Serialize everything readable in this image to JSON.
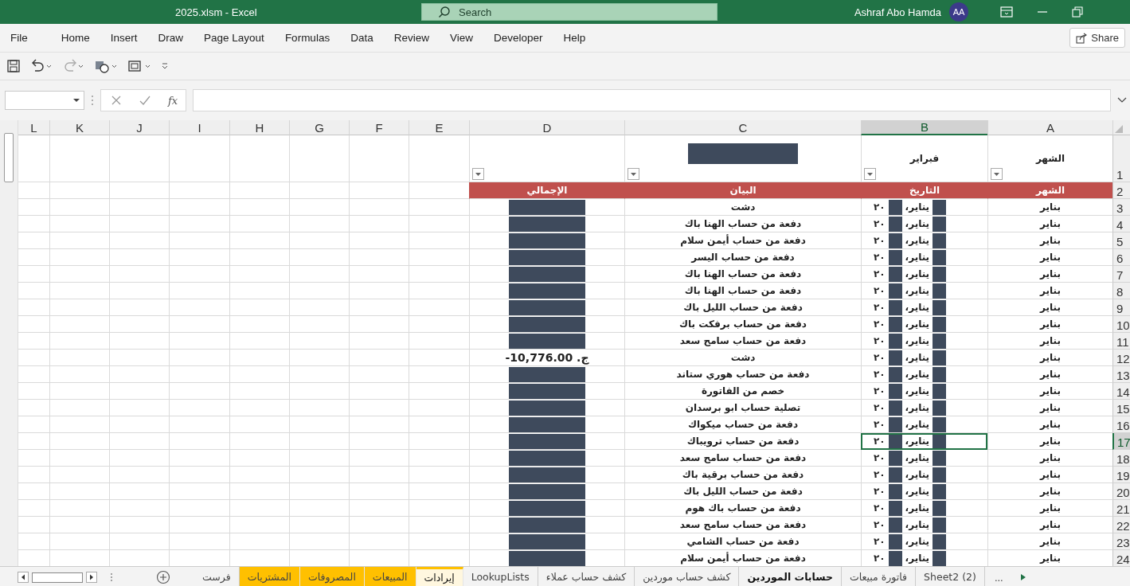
{
  "window": {
    "title": "2025.xlsm  -  Excel",
    "search_placeholder": "Search",
    "user": "Ashraf Abo Hamda",
    "avatar": "AA"
  },
  "file_menu": "File",
  "menu": [
    {
      "label": "Help",
      "selected": false
    },
    {
      "label": "Developer",
      "selected": false
    },
    {
      "label": "View",
      "selected": false
    },
    {
      "label": "Review",
      "selected": false
    },
    {
      "label": "Data",
      "selected": false
    },
    {
      "label": "Formulas",
      "selected": false
    },
    {
      "label": "Page Layout",
      "selected": false
    },
    {
      "label": "Draw",
      "selected": false
    },
    {
      "label": "Insert",
      "selected": false
    },
    {
      "label": "Home",
      "selected": false
    }
  ],
  "share_label": "Share",
  "formula_bar": {
    "fx": "fx"
  },
  "columns": [
    {
      "label": "A",
      "selected": false
    },
    {
      "label": "B",
      "selected": true
    },
    {
      "label": "C",
      "selected": false
    },
    {
      "label": "D",
      "selected": false
    },
    {
      "label": "E",
      "selected": false
    },
    {
      "label": "F",
      "selected": false
    },
    {
      "label": "G",
      "selected": false
    },
    {
      "label": "H",
      "selected": false
    },
    {
      "label": "I",
      "selected": false
    },
    {
      "label": "J",
      "selected": false
    },
    {
      "label": "K",
      "selected": false
    },
    {
      "label": "L",
      "selected": false
    }
  ],
  "title_row": {
    "number": "1",
    "cells": [
      {
        "kind": "text",
        "text": "الشهر",
        "filter": true
      },
      {
        "kind": "text",
        "text": "فبراير",
        "filter": true
      },
      {
        "kind": "redacted",
        "filter": true
      },
      {
        "kind": "empty",
        "filter": true
      }
    ]
  },
  "header_row": {
    "number": "2",
    "cells": [
      "الشهر",
      "التاريخ",
      "البيان",
      "الإجمالي"
    ]
  },
  "rows": [
    {
      "number": "3",
      "month": "بناير",
      "date_month": "يناير،",
      "date_year": "٢٠",
      "description": "دشت",
      "total": {
        "kind": "redacted"
      },
      "selected": false
    },
    {
      "number": "4",
      "month": "بناير",
      "date_month": "يناير،",
      "date_year": "٢٠",
      "description": "دفعة من حساب الهنا باك",
      "total": {
        "kind": "redacted"
      },
      "selected": false
    },
    {
      "number": "5",
      "month": "بناير",
      "date_month": "يناير،",
      "date_year": "٢٠",
      "description": "دفعة من حساب أيمن سلام",
      "total": {
        "kind": "redacted"
      },
      "selected": false
    },
    {
      "number": "6",
      "month": "بناير",
      "date_month": "يناير،",
      "date_year": "٢٠",
      "description": "دفعة من حساب اليسر",
      "total": {
        "kind": "redacted"
      },
      "selected": false
    },
    {
      "number": "7",
      "month": "بناير",
      "date_month": "يناير،",
      "date_year": "٢٠",
      "description": "دفعة من حساب الهنا باك",
      "total": {
        "kind": "redacted"
      },
      "selected": false
    },
    {
      "number": "8",
      "month": "بناير",
      "date_month": "يناير،",
      "date_year": "٢٠",
      "description": "دفعة من حساب الهنا باك",
      "total": {
        "kind": "redacted"
      },
      "selected": false
    },
    {
      "number": "9",
      "month": "بناير",
      "date_month": "يناير،",
      "date_year": "٢٠",
      "description": "دفعة من حساب الليل باك",
      "total": {
        "kind": "redacted"
      },
      "selected": false
    },
    {
      "number": "10",
      "month": "بناير",
      "date_month": "يناير،",
      "date_year": "٢٠",
      "description": "دفعة من حساب برفكت باك",
      "total": {
        "kind": "redacted"
      },
      "selected": false
    },
    {
      "number": "11",
      "month": "بناير",
      "date_month": "يناير،",
      "date_year": "٢٠",
      "description": "دفعة من حساب سامح سعد",
      "total": {
        "kind": "redacted"
      },
      "selected": false
    },
    {
      "number": "12",
      "month": "بناير",
      "date_month": "يناير،",
      "date_year": "٢٠",
      "description": "دشت",
      "total": {
        "kind": "text",
        "text": "-10,776.00 .ج"
      },
      "selected": false
    },
    {
      "number": "13",
      "month": "بناير",
      "date_month": "يناير،",
      "date_year": "٢٠",
      "description": "دفعة من حساب هوري ستاند",
      "total": {
        "kind": "redacted"
      },
      "selected": false
    },
    {
      "number": "14",
      "month": "بناير",
      "date_month": "يناير،",
      "date_year": "٢٠",
      "description": "خصم من الفاتورة",
      "total": {
        "kind": "redacted"
      },
      "selected": false
    },
    {
      "number": "15",
      "month": "بناير",
      "date_month": "يناير،",
      "date_year": "٢٠",
      "description": "تصلية حساب ابو برسدان",
      "total": {
        "kind": "redacted"
      },
      "selected": false
    },
    {
      "number": "16",
      "month": "بناير",
      "date_month": "يناير،",
      "date_year": "٢٠",
      "description": "دفعة من حساب ميكواك",
      "total": {
        "kind": "redacted"
      },
      "selected": false
    },
    {
      "number": "17",
      "month": "بناير",
      "date_month": "يناير،",
      "date_year": "٢٠",
      "description": "دفعة من حساب ترويباك",
      "total": {
        "kind": "redacted"
      },
      "selected": true
    },
    {
      "number": "18",
      "month": "بناير",
      "date_month": "يناير،",
      "date_year": "٢٠",
      "description": "دفعة من حساب سامح سعد",
      "total": {
        "kind": "redacted"
      },
      "selected": false
    },
    {
      "number": "19",
      "month": "بناير",
      "date_month": "يناير،",
      "date_year": "٢٠",
      "description": "دفعة من حساب برقية باك",
      "total": {
        "kind": "redacted"
      },
      "selected": false
    },
    {
      "number": "20",
      "month": "بناير",
      "date_month": "يناير،",
      "date_year": "٢٠",
      "description": "دفعة من حساب الليل باك",
      "total": {
        "kind": "redacted"
      },
      "selected": false
    },
    {
      "number": "21",
      "month": "بناير",
      "date_month": "يناير،",
      "date_year": "٢٠",
      "description": "دفعة من حساب باك هوم",
      "total": {
        "kind": "redacted"
      },
      "selected": false
    },
    {
      "number": "22",
      "month": "بناير",
      "date_month": "يناير،",
      "date_year": "٢٠",
      "description": "دفعة من حساب سامح سعد",
      "total": {
        "kind": "redacted"
      },
      "selected": false
    },
    {
      "number": "23",
      "month": "بناير",
      "date_month": "يناير،",
      "date_year": "٢٠",
      "description": "دفعة من حساب الشامي",
      "total": {
        "kind": "redacted"
      },
      "selected": false
    },
    {
      "number": "24",
      "month": "بناير",
      "date_month": "يناير،",
      "date_year": "٢٠",
      "description": "دفعة من حساب أيمن سلام",
      "total": {
        "kind": "redacted"
      },
      "selected": false
    }
  ],
  "sheet_tabs": [
    {
      "label": "Sheet2 (2)",
      "selected": false
    },
    {
      "label": "فاتورة مبيعات",
      "selected": false
    },
    {
      "label": "حسابات الموردين",
      "selected": true
    },
    {
      "label": "كشف حساب موردين",
      "selected": false
    },
    {
      "label": "كشف حساب عملاء",
      "selected": false
    },
    {
      "label": "LookupLists",
      "selected": false
    },
    {
      "label": "إيرادات",
      "selected": true,
      "color": "#ffc000"
    },
    {
      "label": "المبيعات",
      "selected": false,
      "color": "#ffc000"
    },
    {
      "label": "المصروفات",
      "selected": false,
      "color": "#ffc000"
    },
    {
      "label": "المشتريات",
      "selected": false,
      "color": "#ffc000"
    },
    {
      "label": "فرست",
      "selected": false
    }
  ],
  "more_tabs": "..."
}
